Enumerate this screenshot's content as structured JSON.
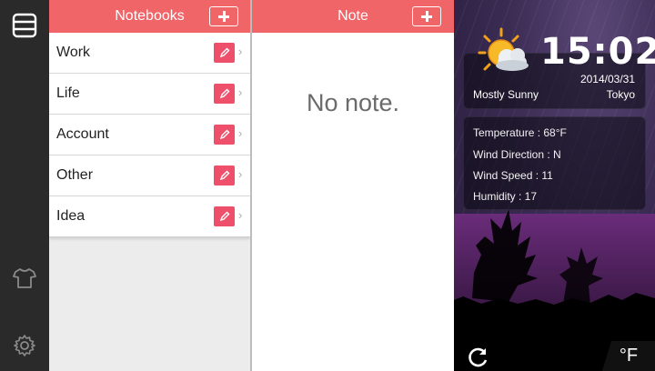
{
  "rail": {
    "menu_icon": "menu-icon",
    "theme_icon": "tshirt-icon",
    "settings_icon": "gear-icon"
  },
  "notebooks": {
    "title": "Notebooks",
    "items": [
      {
        "label": "Work"
      },
      {
        "label": "Life"
      },
      {
        "label": "Account"
      },
      {
        "label": "Other"
      },
      {
        "label": "Idea"
      }
    ]
  },
  "note": {
    "title": "Note",
    "empty_text": "No note."
  },
  "weather": {
    "time": "15:02",
    "date": "2014/03/31",
    "condition": "Mostly Sunny",
    "city": "Tokyo",
    "details": [
      {
        "text": "Temperature : 68°F"
      },
      {
        "text": "Wind Direction : N"
      },
      {
        "text": "Wind Speed : 11"
      },
      {
        "text": "Humidity : 17"
      }
    ],
    "unit_label": "°F"
  },
  "colors": {
    "accent": "#f06567",
    "edit": "#ee4f6a"
  }
}
